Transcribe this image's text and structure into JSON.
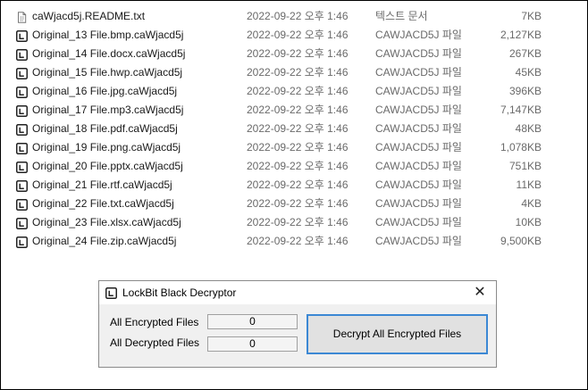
{
  "files": [
    {
      "name": "caWjacd5j.README.txt",
      "date": "2022-09-22 오후 1:46",
      "type": "텍스트 문서",
      "size": "7KB",
      "icon": "text-file-icon"
    },
    {
      "name": "Original_13 File.bmp.caWjacd5j",
      "date": "2022-09-22 오후 1:46",
      "type": "CAWJACD5J 파일",
      "size": "2,127KB",
      "icon": "lockbit-file-icon"
    },
    {
      "name": "Original_14 File.docx.caWjacd5j",
      "date": "2022-09-22 오후 1:46",
      "type": "CAWJACD5J 파일",
      "size": "267KB",
      "icon": "lockbit-file-icon"
    },
    {
      "name": "Original_15 File.hwp.caWjacd5j",
      "date": "2022-09-22 오후 1:46",
      "type": "CAWJACD5J 파일",
      "size": "45KB",
      "icon": "lockbit-file-icon"
    },
    {
      "name": "Original_16 File.jpg.caWjacd5j",
      "date": "2022-09-22 오후 1:46",
      "type": "CAWJACD5J 파일",
      "size": "396KB",
      "icon": "lockbit-file-icon"
    },
    {
      "name": "Original_17 File.mp3.caWjacd5j",
      "date": "2022-09-22 오후 1:46",
      "type": "CAWJACD5J 파일",
      "size": "7,147KB",
      "icon": "lockbit-file-icon"
    },
    {
      "name": "Original_18 File.pdf.caWjacd5j",
      "date": "2022-09-22 오후 1:46",
      "type": "CAWJACD5J 파일",
      "size": "48KB",
      "icon": "lockbit-file-icon"
    },
    {
      "name": "Original_19 File.png.caWjacd5j",
      "date": "2022-09-22 오후 1:46",
      "type": "CAWJACD5J 파일",
      "size": "1,078KB",
      "icon": "lockbit-file-icon"
    },
    {
      "name": "Original_20 File.pptx.caWjacd5j",
      "date": "2022-09-22 오후 1:46",
      "type": "CAWJACD5J 파일",
      "size": "751KB",
      "icon": "lockbit-file-icon"
    },
    {
      "name": "Original_21 File.rtf.caWjacd5j",
      "date": "2022-09-22 오후 1:46",
      "type": "CAWJACD5J 파일",
      "size": "11KB",
      "icon": "lockbit-file-icon"
    },
    {
      "name": "Original_22 File.txt.caWjacd5j",
      "date": "2022-09-22 오후 1:46",
      "type": "CAWJACD5J 파일",
      "size": "4KB",
      "icon": "lockbit-file-icon"
    },
    {
      "name": "Original_23 File.xlsx.caWjacd5j",
      "date": "2022-09-22 오후 1:46",
      "type": "CAWJACD5J 파일",
      "size": "10KB",
      "icon": "lockbit-file-icon"
    },
    {
      "name": "Original_24 File.zip.caWjacd5j",
      "date": "2022-09-22 오후 1:46",
      "type": "CAWJACD5J 파일",
      "size": "9,500KB",
      "icon": "lockbit-file-icon"
    }
  ],
  "dialog": {
    "title": "LockBit Black Decryptor",
    "title_icon": "lockbit-app-icon",
    "close_label": "✕",
    "encrypted_label": "All Encrypted Files",
    "encrypted_value": "0",
    "decrypted_label": "All Decrypted Files",
    "decrypted_value": "0",
    "decrypt_button_label": "Decrypt All Encrypted Files",
    "accent_color": "#3c88d4"
  }
}
